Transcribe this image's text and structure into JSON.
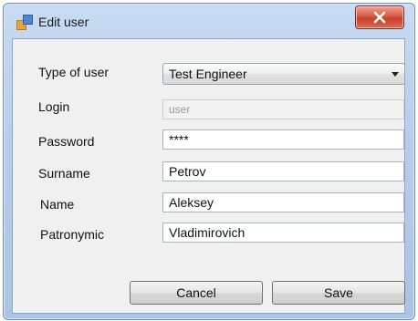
{
  "window": {
    "title": "Edit user"
  },
  "form": {
    "type_label": "Type of user",
    "type_value": "Test Engineer",
    "login_label": "Login",
    "login_placeholder": "user",
    "password_label": "Password",
    "password_value": "****",
    "surname_label": "Surname",
    "surname_value": "Petrov",
    "name_label": "Name",
    "name_value": "Aleksey",
    "patronymic_label": "Patronymic",
    "patronymic_value": "Vladimirovich"
  },
  "buttons": {
    "cancel": "Cancel",
    "save": "Save"
  },
  "icons": {
    "app": "app-window-icon",
    "close": "close-icon",
    "dropdown": "chevron-down-icon"
  }
}
